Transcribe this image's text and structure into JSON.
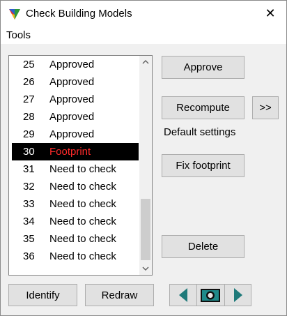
{
  "window": {
    "title": "Check Building Models",
    "close_glyph": "✕"
  },
  "menu": {
    "tools_label": "Tools"
  },
  "list": {
    "rows": [
      {
        "num": "25",
        "status": "Approved"
      },
      {
        "num": "26",
        "status": "Approved"
      },
      {
        "num": "27",
        "status": "Approved"
      },
      {
        "num": "28",
        "status": "Approved"
      },
      {
        "num": "29",
        "status": "Approved"
      },
      {
        "num": "30",
        "status": "Footprint"
      },
      {
        "num": "31",
        "status": "Need to check"
      },
      {
        "num": "32",
        "status": "Need to check"
      },
      {
        "num": "33",
        "status": "Need to check"
      },
      {
        "num": "34",
        "status": "Need to check"
      },
      {
        "num": "35",
        "status": "Need to check"
      },
      {
        "num": "36",
        "status": "Need to check"
      }
    ],
    "selected_num": "30"
  },
  "actions": {
    "approve": "Approve",
    "recompute": "Recompute",
    "more": ">>",
    "default_settings": "Default settings",
    "fix_footprint": "Fix footprint",
    "delete": "Delete"
  },
  "bottom": {
    "identify": "Identify",
    "redraw": "Redraw"
  },
  "colors": {
    "selected_bg": "#000000",
    "selected_status": "#ff2a2a",
    "nav_arrow": "#1f7a7a"
  },
  "icons": {
    "app": "triangle-logo-icon",
    "prev": "arrow-left-icon",
    "camera": "camera-icon",
    "next": "arrow-right-icon"
  }
}
